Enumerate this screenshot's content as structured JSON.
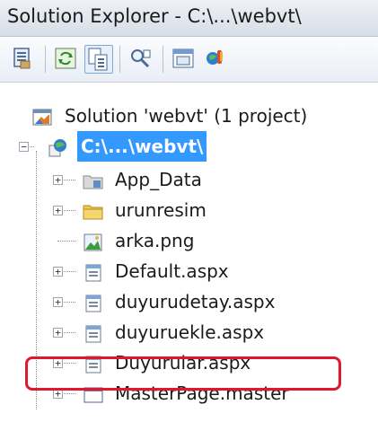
{
  "window": {
    "title": "Solution Explorer - C:\\...\\webvt\\"
  },
  "toolbar": {
    "buttons": [
      {
        "icon": "properties-icon"
      },
      {
        "icon": "refresh-icon"
      },
      {
        "icon": "show-all-files-icon"
      },
      {
        "icon": "view-code-icon"
      },
      {
        "icon": "view-designer-icon"
      },
      {
        "icon": "copy-website-icon"
      }
    ]
  },
  "tree": {
    "solution": {
      "label": "Solution 'webvt' (1 project)",
      "icon": "solution-icon"
    },
    "project": {
      "label": "C:\\...\\webvt\\",
      "icon": "web-project-icon",
      "selected": true
    },
    "items": [
      {
        "label": "App_Data",
        "icon": "special-folder-icon"
      },
      {
        "label": "urunresim",
        "icon": "folder-icon"
      },
      {
        "label": "arka.png",
        "icon": "image-file-icon"
      },
      {
        "label": "Default.aspx",
        "icon": "aspx-page-icon"
      },
      {
        "label": "duyurudetay.aspx",
        "icon": "aspx-page-icon"
      },
      {
        "label": "duyuruekle.aspx",
        "icon": "aspx-page-icon"
      },
      {
        "label": "Duyurular.aspx",
        "icon": "aspx-page-icon",
        "highlighted": true
      },
      {
        "label": "MasterPage.master",
        "icon": "master-page-icon"
      }
    ]
  },
  "colors": {
    "selection": "#3399ff",
    "highlight_border": "#e0182b"
  }
}
